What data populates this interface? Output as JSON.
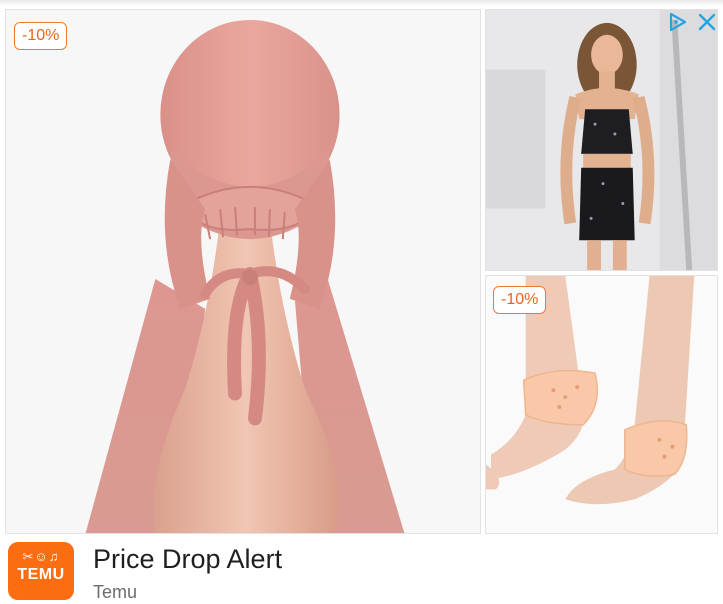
{
  "ad": {
    "title": "Price Drop Alert",
    "advertiser": "Temu",
    "logo_text": "TEMU",
    "logo_glyphs": "✂☺♫",
    "brand_color": "#fb6d10"
  },
  "products": [
    {
      "discount": "-10%",
      "image": "pink-hijab-cap-on-mannequin"
    },
    {
      "image": "woman-in-black-sequin-halter-dress"
    },
    {
      "discount": "-10%",
      "image": "silicone-heel-protector-sleeves"
    }
  ],
  "icons": {
    "adchoices": "adchoices-icon",
    "close": "close-icon"
  },
  "colors": {
    "badge": "#f07a2f",
    "adchoices": "#27a4e0"
  }
}
